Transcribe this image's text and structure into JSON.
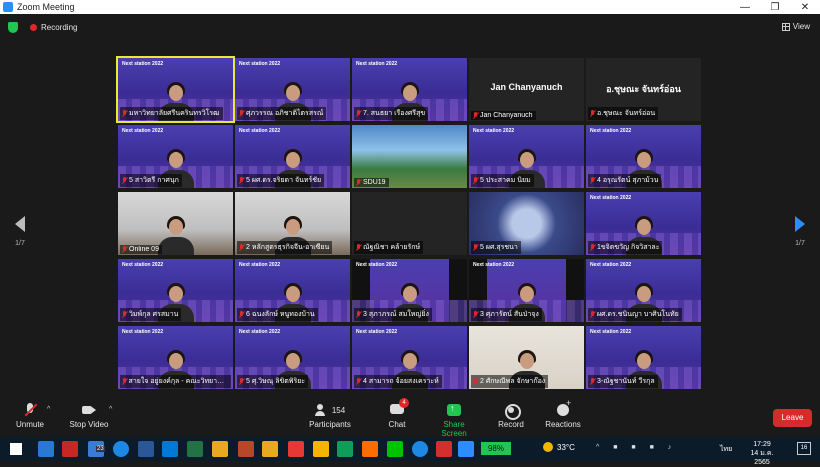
{
  "window": {
    "title": "Zoom Meeting",
    "controls": [
      "—",
      "❐",
      "✕"
    ]
  },
  "topbar": {
    "recording_label": "Recording",
    "view_label": "View"
  },
  "tile_brand": "Next station 2022",
  "tiles": [
    {
      "name": "มหาวิทยาลัยศรีนครินทรวิโรฒ",
      "style": "stage",
      "active": true
    },
    {
      "name": "ศุภวรรณ อภิชาติไตรสรณ์",
      "style": "person"
    },
    {
      "name": "7. สนธยา เรืองศรีสุข",
      "style": "person"
    },
    {
      "name": "Jan Chanyanuch",
      "style": "dark",
      "big": "Jan Chanyanuch"
    },
    {
      "name": "อ.ชุษณะ จันทร์อ่อน",
      "style": "dark",
      "big": "อ.ชุษณะ จันทร์อ่อน"
    },
    {
      "name": "5 สาวิตรี กาศนุก",
      "style": "person"
    },
    {
      "name": "5 ผศ.ดร.จริยดา จันทร์ชัย",
      "style": "person"
    },
    {
      "name": "SDU19",
      "style": "photo"
    },
    {
      "name": "5 ประสาคม นิยม",
      "style": "person"
    },
    {
      "name": "4 อรุณรัตน์ สุภาม้วน",
      "style": "person"
    },
    {
      "name": "Online 09",
      "style": "office"
    },
    {
      "name": "2 หลักสูตรธุรกิจจีน-อาเซียน",
      "style": "office"
    },
    {
      "name": "ณัฐณิชา คล้ายรักษ์",
      "style": "dark",
      "big": ""
    },
    {
      "name": "5 ผศ.สุรชนา",
      "style": "blur"
    },
    {
      "name": "1ขจิตขวัญ กิจวิสาละ",
      "style": "person"
    },
    {
      "name": "วิมพ์กุล ศรสมาน",
      "style": "person"
    },
    {
      "name": "6 ฉนงลักษ์ หนูทองบ้าน",
      "style": "person"
    },
    {
      "name": "3 สุภาภรณ์ สมใหญ่ยิ่ง",
      "style": "black"
    },
    {
      "name": "3 ศุภารัตน์ สันป่าจุง",
      "style": "black"
    },
    {
      "name": "ผศ.ดร.ชนินญา บาศินโนทัย",
      "style": "person"
    },
    {
      "name": "สายใจ อยู่ยงค์กุล - คณะวิทยาศาสตร์",
      "style": "person"
    },
    {
      "name": "5 ศุ.วิษณุ ลิขิตพิริยะ",
      "style": "person"
    },
    {
      "name": "4 สามารถ จ้อยสงเคราะห์",
      "style": "person"
    },
    {
      "name": "2 ศักษณีพล จักษาก๊อง",
      "style": "lightroom"
    },
    {
      "name": "3-ณัฐชานันท์ วีรกุล",
      "style": "person"
    }
  ],
  "nav": {
    "left_page": "1/7",
    "right_page": "1/7"
  },
  "toolbar": {
    "unmute": "Unmute",
    "stop_video": "Stop Video",
    "participants": "Participants",
    "participants_count": "154",
    "chat": "Chat",
    "chat_badge": "4",
    "share": "Share Screen",
    "record": "Record",
    "reactions": "Reactions",
    "leave": "Leave"
  },
  "taskbar": {
    "badge_23": "23",
    "battery": "98%",
    "temperature": "33°C",
    "language": "ไทย",
    "time": "17:29",
    "date": "14 ม.ค. 2565",
    "notifications": "16"
  },
  "colors": {
    "accent": "#2d8cff",
    "share_green": "#23c552",
    "leave_red": "#d62b2b",
    "active_tile": "#e8e83a"
  }
}
